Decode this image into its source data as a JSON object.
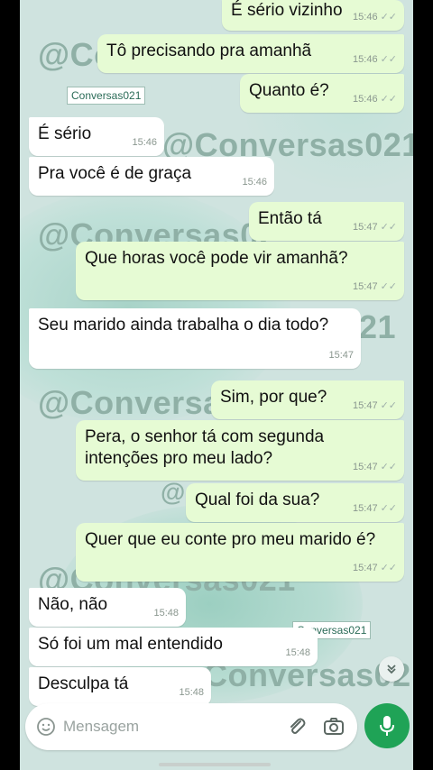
{
  "watermarks": [
    {
      "text": "@Co"
    },
    {
      "text": "@Conversas021"
    },
    {
      "text": "@Conversas02"
    },
    {
      "text": "21"
    },
    {
      "text": "@Conversas"
    },
    {
      "text": "@"
    },
    {
      "text": "@Conversas021"
    },
    {
      "text": "Conversas02"
    }
  ],
  "tags": [
    "Conversas021",
    "Conversas021"
  ],
  "messages": [
    {
      "dir": "out",
      "text": "É sério vizinho",
      "time": "15:46"
    },
    {
      "dir": "out",
      "text": "Tô precisando pra amanhã",
      "time": "15:46"
    },
    {
      "dir": "out",
      "text": "Quanto é?",
      "time": "15:46"
    },
    {
      "dir": "in",
      "text": "É sério",
      "time": "15:46"
    },
    {
      "dir": "in",
      "text": "Pra você é de graça",
      "time": "15:46"
    },
    {
      "dir": "out",
      "text": "Então tá",
      "time": "15:47"
    },
    {
      "dir": "out",
      "text": "Que horas você pode vir amanhã?",
      "time": "15:47"
    },
    {
      "dir": "in",
      "text": "Seu marido ainda trabalha o dia todo?",
      "time": "15:47"
    },
    {
      "dir": "out",
      "text": "Sim, por que?",
      "time": "15:47"
    },
    {
      "dir": "out",
      "text": "Pera, o senhor tá com segunda intenções pro meu lado?",
      "time": "15:47"
    },
    {
      "dir": "out",
      "text": "Qual foi da sua?",
      "time": "15:47"
    },
    {
      "dir": "out",
      "text": "Quer que eu conte pro meu marido é?",
      "time": "15:47"
    },
    {
      "dir": "in",
      "text": "Não, não",
      "time": "15:48"
    },
    {
      "dir": "in",
      "text": "Só foi um mal entendido",
      "time": "15:48"
    },
    {
      "dir": "in",
      "text": "Desculpa tá",
      "time": "15:48"
    }
  ],
  "composer": {
    "placeholder": "Mensagem"
  },
  "icons": {
    "emoji": "emoji-icon",
    "attach": "paperclip-icon",
    "camera": "camera-icon",
    "mic": "microphone-icon",
    "scroll": "double-chevron-down-icon",
    "ticks": "double-check-icon"
  },
  "colors": {
    "wallpaper": "#cfe3df",
    "incoming": "#ffffff",
    "outgoing": "#e6fbd4",
    "mic_button": "#1fa356"
  }
}
